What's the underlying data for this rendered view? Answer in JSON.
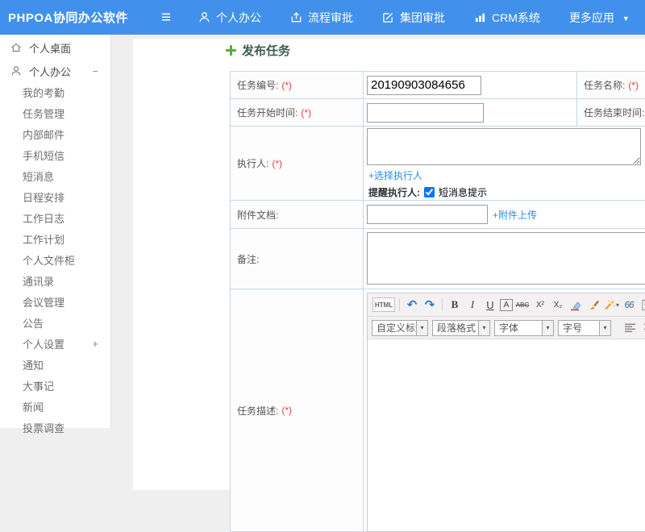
{
  "header": {
    "logo": "PHPOA协同办公软件",
    "nav": [
      {
        "label": "个人办公"
      },
      {
        "label": "流程审批"
      },
      {
        "label": "集团审批"
      },
      {
        "label": "CRM系统"
      },
      {
        "label": "更多应用"
      }
    ]
  },
  "sidebar": {
    "items": [
      {
        "label": "个人桌面"
      },
      {
        "label": "个人办公",
        "toggle": "−"
      },
      {
        "label": "我的考勤"
      },
      {
        "label": "任务管理"
      },
      {
        "label": "内部邮件"
      },
      {
        "label": "手机短信"
      },
      {
        "label": "短消息"
      },
      {
        "label": "日程安排"
      },
      {
        "label": "工作日志"
      },
      {
        "label": "工作计划"
      },
      {
        "label": "个人文件柜"
      },
      {
        "label": "通讯录"
      },
      {
        "label": "会议管理"
      },
      {
        "label": "公告"
      },
      {
        "label": "个人设置",
        "toggle": "+"
      },
      {
        "label": "通知"
      },
      {
        "label": "大事记"
      },
      {
        "label": "新闻"
      },
      {
        "label": "投票调查"
      }
    ]
  },
  "page": {
    "title": "发布任务"
  },
  "form": {
    "required_mark": "(*)",
    "task_no_label": "任务编号:",
    "task_no_value": "20190903084656",
    "task_name_label": "任务名称:",
    "start_label": "任务开始时间:",
    "end_label": "任务结束时间:",
    "executor_label": "执行人:",
    "choose_executor_link": "+选择执行人",
    "remind_label": "提醒执行人:",
    "sms_checkbox_label": "短消息提示",
    "attach_label": "附件文档:",
    "attach_upload_link": "+附件上传",
    "remark_label": "备注:",
    "desc_label": "任务描述:"
  },
  "editor": {
    "buttons": {
      "html": "HTML",
      "undo": "↶",
      "redo": "↷",
      "bold": "B",
      "italic": "I",
      "underline": "U",
      "font_box": "A",
      "strike": "ABC",
      "sup": "X²",
      "sub": "X₂",
      "quote": "66",
      "color": "A"
    },
    "selects": [
      {
        "label": "自定义标题"
      },
      {
        "label": "段落格式"
      },
      {
        "label": "字体"
      },
      {
        "label": "字号"
      }
    ]
  },
  "glyphs": {
    "hamburger": "≡",
    "dropdown_caret": "▼",
    "mini_caret": "▾"
  }
}
